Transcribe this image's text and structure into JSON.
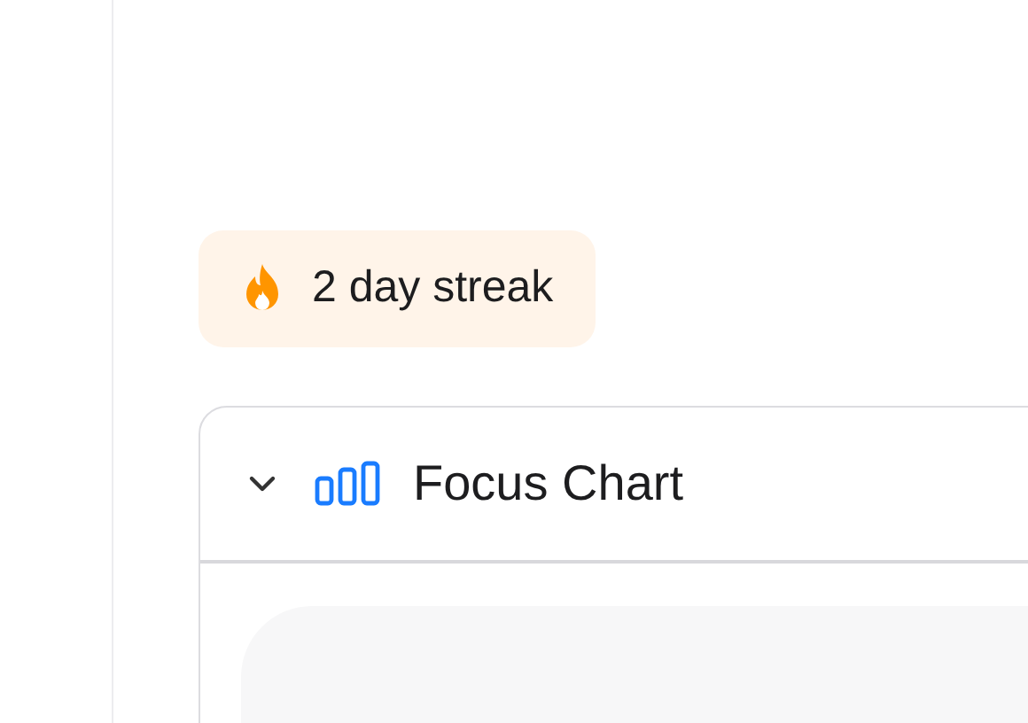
{
  "streak": {
    "label": "2 day streak"
  },
  "focus_chart": {
    "title": "Focus Chart",
    "expanded": true
  }
}
